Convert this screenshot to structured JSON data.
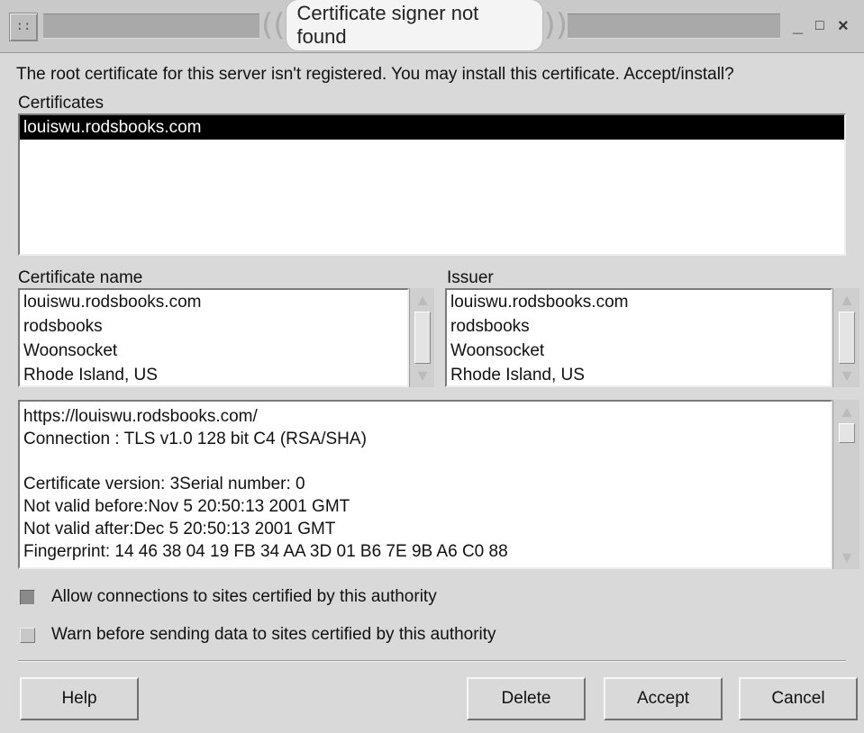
{
  "window": {
    "title": "Certificate signer not found",
    "controls": {
      "minimize": "_",
      "maximize": "□",
      "close": "×"
    }
  },
  "message": "The root certificate for this server isn't registered. You may install this certificate. Accept/install?",
  "certificates": {
    "label": "Certificates",
    "items": [
      "louiswu.rodsbooks.com"
    ],
    "selected_index": 0
  },
  "certificate_name": {
    "label": "Certificate name",
    "lines": [
      "louiswu.rodsbooks.com",
      "rodsbooks",
      "Woonsocket",
      "Rhode Island, US"
    ]
  },
  "issuer": {
    "label": "Issuer",
    "lines": [
      "louiswu.rodsbooks.com",
      "rodsbooks",
      "Woonsocket",
      "Rhode Island, US"
    ]
  },
  "details": {
    "lines": [
      "https://louiswu.rodsbooks.com/",
      "Connection : TLS v1.0   128 bit C4 (RSA/SHA)",
      "",
      "Certificate version: 3Serial number: 0",
      "Not valid before:Nov  5 20:50:13 2001 GMT",
      "Not valid after:Dec  5 20:50:13 2001 GMT",
      "Fingerprint: 14 46 38 04 19 FB 34 AA 3D 01 B6 7E 9B A6 C0 88"
    ]
  },
  "options": {
    "allow": {
      "label": "Allow connections to sites certified by this authority",
      "checked": true
    },
    "warn": {
      "label": "Warn before sending data to sites certified by this authority",
      "checked": false
    }
  },
  "buttons": {
    "help": "Help",
    "delete": "Delete",
    "accept": "Accept",
    "cancel": "Cancel"
  },
  "icons": {
    "grip": "grip-icon",
    "scroll_up": "scroll-up-arrow-icon",
    "scroll_down": "scroll-down-arrow-icon"
  }
}
